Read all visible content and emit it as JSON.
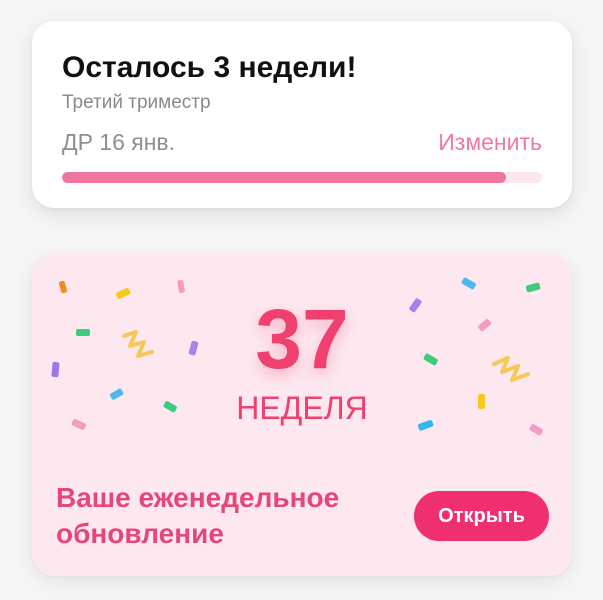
{
  "due_card": {
    "title": "Осталось 3 недели!",
    "subtitle": "Третий триместр",
    "due_date": "ДР 16 янв.",
    "change_label": "Изменить",
    "progress": 0.925,
    "accent_color": "#f0769b"
  },
  "week_card": {
    "week_number": "37",
    "week_label": "НЕДЕЛЯ",
    "update_title": "Ваше еженедельное обновление",
    "open_label": "Открыть",
    "background_color": "#fde8ef",
    "number_color": "#f0406f",
    "button_color": "#ef2f6f"
  }
}
